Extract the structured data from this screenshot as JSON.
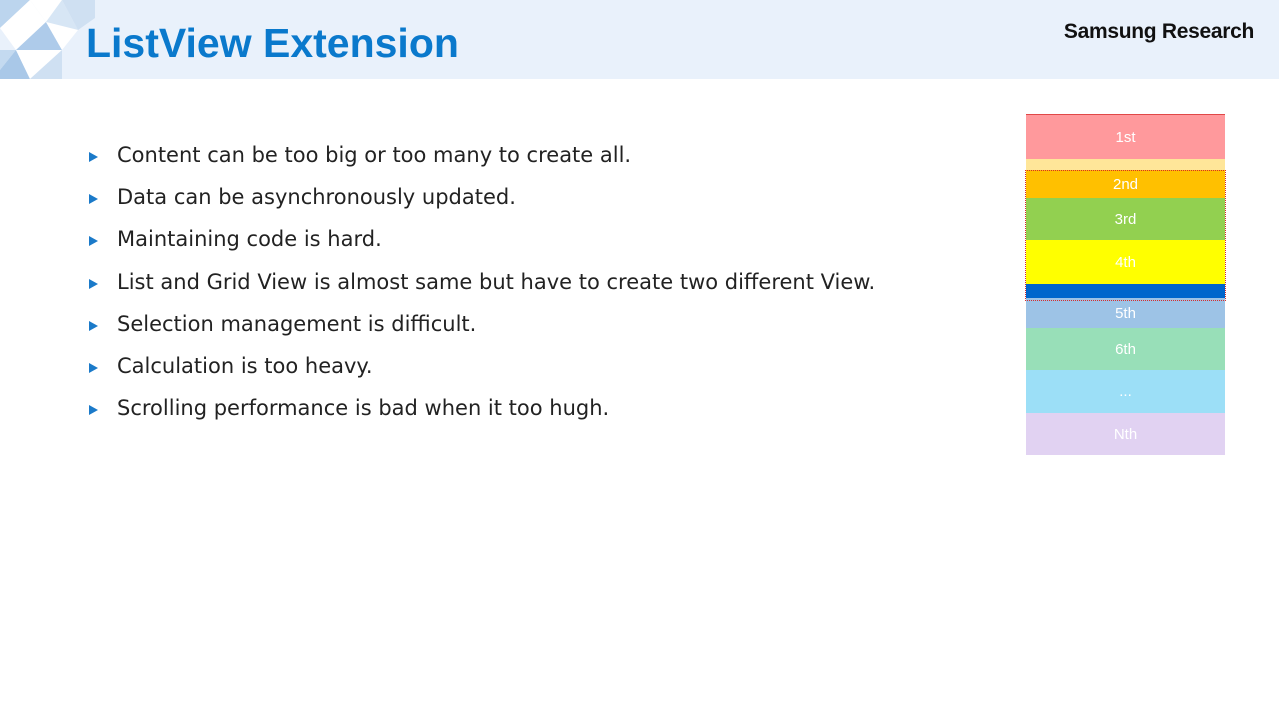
{
  "title": "ListView  Extension",
  "brand": "Samsung Research",
  "bullets": [
    "Content can be too big or too many to create all.",
    "Data can be asynchronously updated.",
    "Maintaining code is hard.",
    "List and Grid View is almost same but have to create two different View.",
    "Selection management is difficult.",
    "Calculation is too heavy.",
    "Scrolling performance is bad when it too hugh."
  ],
  "list_items": [
    {
      "label": "1st",
      "color": "#ff999c"
    },
    {
      "label": "2nd",
      "color": "#ffc000"
    },
    {
      "label": "3rd",
      "color": "#92d050"
    },
    {
      "label": "4th",
      "color": "#ffff00"
    },
    {
      "label": "5th",
      "color": "#9dc3e6"
    },
    {
      "label": "6th",
      "color": "#98dfb8"
    },
    {
      "label": "...",
      "color": "#9cdff7"
    },
    {
      "label": "Nth",
      "color": "#e1d2f2"
    }
  ],
  "colors": {
    "header_bg": "#e9f1fb",
    "title": "#0a79cc",
    "bullet_marker": "#1b7ac9",
    "viewport_frame": "#d62b2b",
    "highlight_band_top": "#ffe699",
    "highlight_band_bottom": "#0066cc"
  }
}
